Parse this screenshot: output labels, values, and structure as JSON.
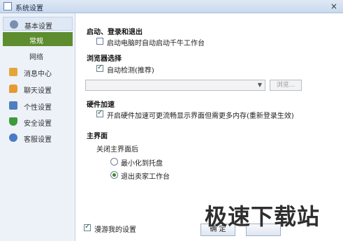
{
  "window": {
    "title": "系统设置",
    "close_glyph": "×"
  },
  "sidebar": {
    "items": [
      {
        "label": "基本设置",
        "icon": "gear-icon",
        "color": "#7a8fb0"
      },
      {
        "label": "常规"
      },
      {
        "label": "网络"
      },
      {
        "label": "消息中心",
        "icon": "mail-icon",
        "color": "#e3a63a"
      },
      {
        "label": "聊天设置",
        "icon": "chat-icon",
        "color": "#e59a2f"
      },
      {
        "label": "个性设置",
        "icon": "window-icon",
        "color": "#4f7fc0"
      },
      {
        "label": "安全设置",
        "icon": "shield-icon",
        "color": "#3e9a3a"
      },
      {
        "label": "客服设置",
        "icon": "headset-icon",
        "color": "#4a7ac4"
      }
    ],
    "active_item": "常规",
    "active_color": "#5d8d2e"
  },
  "sections": {
    "startup": {
      "title": "启动、登录和退出",
      "option": {
        "label": "启动电脑时自动启动千牛工作台",
        "checked": false
      }
    },
    "browser": {
      "title": "浏览器选择",
      "option": {
        "label": "自动检测(推荐)",
        "checked": true
      },
      "select_value": "",
      "browse_label": "浏览..."
    },
    "hardware": {
      "title": "硬件加速",
      "option": {
        "label": "开启硬件加速可更流畅显示界面但需更多内存(重新登录生效)",
        "checked": true
      }
    },
    "main_ui": {
      "title": "主界面",
      "subtitle": "关闭主界面后",
      "radios": [
        {
          "label": "最小化到托盘",
          "checked": false
        },
        {
          "label": "退出卖家工作台",
          "checked": true
        }
      ]
    }
  },
  "footer": {
    "roam": {
      "label": "漫游我的设置",
      "checked": true
    },
    "ok_label": "确 定"
  },
  "watermark": "极速下载站"
}
